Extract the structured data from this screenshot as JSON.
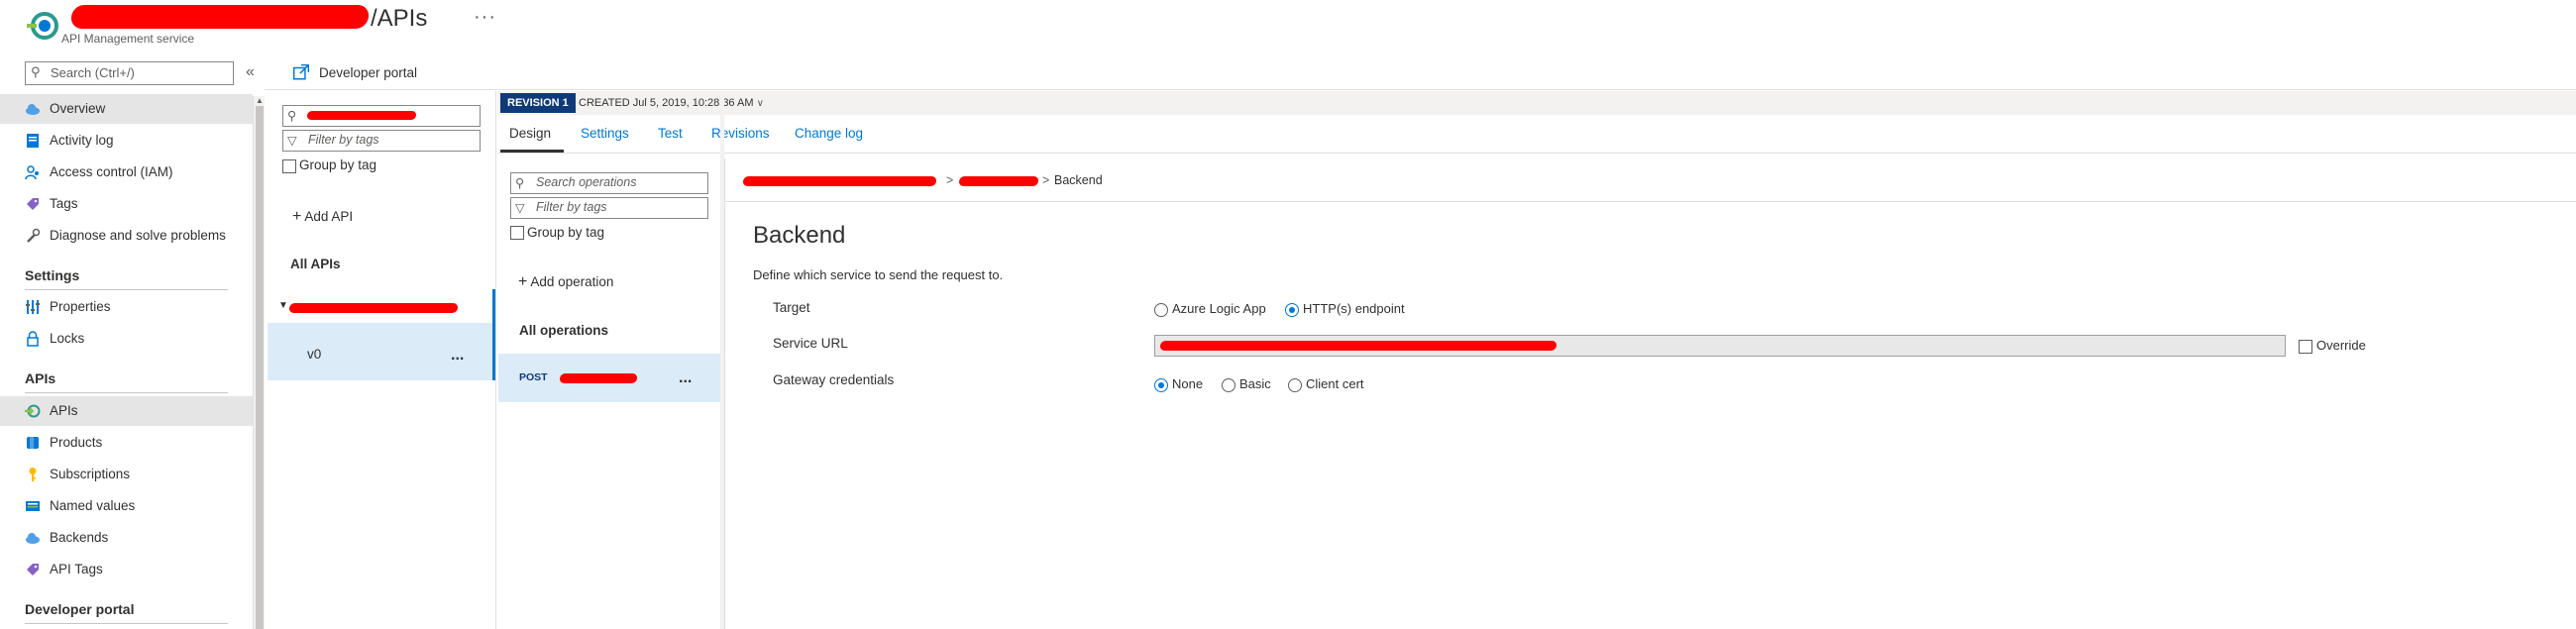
{
  "header": {
    "title_suffix": "/APIs",
    "subtitle": "API Management service",
    "more": "···"
  },
  "nav": {
    "search_placeholder": "Search (Ctrl+/)",
    "collapse": "«",
    "items": [
      {
        "label": "Overview",
        "icon": "cloud-icon",
        "color": "#0078d4"
      },
      {
        "label": "Activity log",
        "icon": "activity-log-icon",
        "color": "#0078d4"
      },
      {
        "label": "Access control (IAM)",
        "icon": "people-icon",
        "color": "#0078d4"
      },
      {
        "label": "Tags",
        "icon": "tag-icon",
        "color": "#8661c5"
      },
      {
        "label": "Diagnose and solve problems",
        "icon": "wrench-icon",
        "color": "#605e5c"
      }
    ],
    "settings_header": "Settings",
    "settings_items": [
      {
        "label": "Properties",
        "icon": "properties-icon"
      },
      {
        "label": "Locks",
        "icon": "lock-icon"
      }
    ],
    "apis_header": "APIs",
    "apis_items": [
      {
        "label": "APIs",
        "icon": "apis-icon"
      },
      {
        "label": "Products",
        "icon": "products-icon"
      },
      {
        "label": "Subscriptions",
        "icon": "key-icon"
      },
      {
        "label": "Named values",
        "icon": "named-values-icon"
      },
      {
        "label": "Backends",
        "icon": "cloud-icon"
      },
      {
        "label": "API Tags",
        "icon": "tag-icon"
      }
    ],
    "devportal_header": "Developer portal"
  },
  "toolbar": {
    "developer_portal": "Developer portal"
  },
  "api_list": {
    "filter_tags_placeholder": "Filter by tags",
    "group_by_tag": "Group by tag",
    "add_api": "Add API",
    "all_apis": "All APIs",
    "version": "v0",
    "more": "..."
  },
  "operations": {
    "search_placeholder": "Search operations",
    "filter_tags_placeholder": "Filter by tags",
    "group_by_tag": "Group by tag",
    "add_operation": "Add operation",
    "all_operations": "All operations",
    "method": "POST",
    "more": "..."
  },
  "revision": {
    "badge": "REVISION 1",
    "created": "CREATED Jul 5, 2019, 10:28:36 AM"
  },
  "tabs": [
    "Design",
    "Settings",
    "Test",
    "Revisions",
    "Change log"
  ],
  "breadcrumb": {
    "sep1": ">",
    "sep2": ">",
    "current": "Backend"
  },
  "backend": {
    "title": "Backend",
    "description": "Define which service to send the request to.",
    "target_label": "Target",
    "target_options": [
      "Azure Logic App",
      "HTTP(s) endpoint"
    ],
    "target_selected": "HTTP(s) endpoint",
    "service_url_label": "Service URL",
    "override_label": "Override",
    "gateway_label": "Gateway credentials",
    "gateway_options": [
      "None",
      "Basic",
      "Client cert"
    ],
    "gateway_selected": "None"
  },
  "colors": {
    "accent": "#0078d4",
    "selected_row": "#dcebf8",
    "revision_badge": "#0f3a7a"
  }
}
